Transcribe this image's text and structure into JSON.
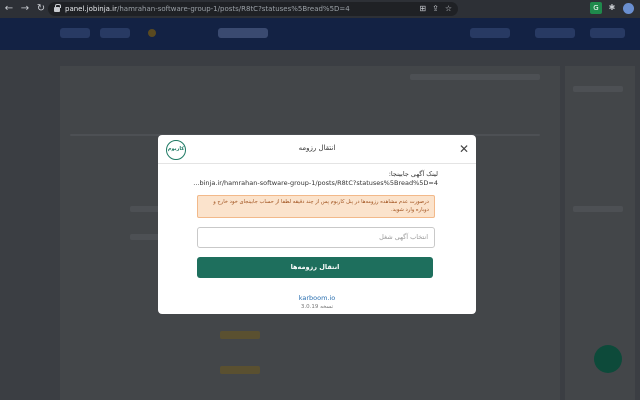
{
  "browser": {
    "url_host": "panel.jobinja.ir",
    "url_path": "/hamrahan-software-group-1/posts/R8tC?statuses%5Bread%5D=4",
    "ext_label": "G"
  },
  "modal": {
    "logo_text": "کاربوم",
    "title": "انتقال رزومه",
    "link_label": "لینک آگهی جابینجا:",
    "link_url": "...binja.ir/hamrahan-software-group-1/posts/R8tC?statuses%5Bread%5D=4",
    "alert_text": "درصورت عدم مشاهده رزومه‌ها در پنل کاربوم پس از چند دقیقه لطفا از حساب جابینجای خود خارج و دوباره وارد شوید.",
    "select_placeholder": "انتخاب آگهی شغل",
    "submit_label": "انتقال رزومه‌ها",
    "footer_link": "karboom.io",
    "version": "نسخه 3.0.19"
  },
  "colors": {
    "primary": "#1e6f5d",
    "alert_bg": "#fbe3cc",
    "alert_text": "#a0521e",
    "header_bg": "#132244"
  }
}
